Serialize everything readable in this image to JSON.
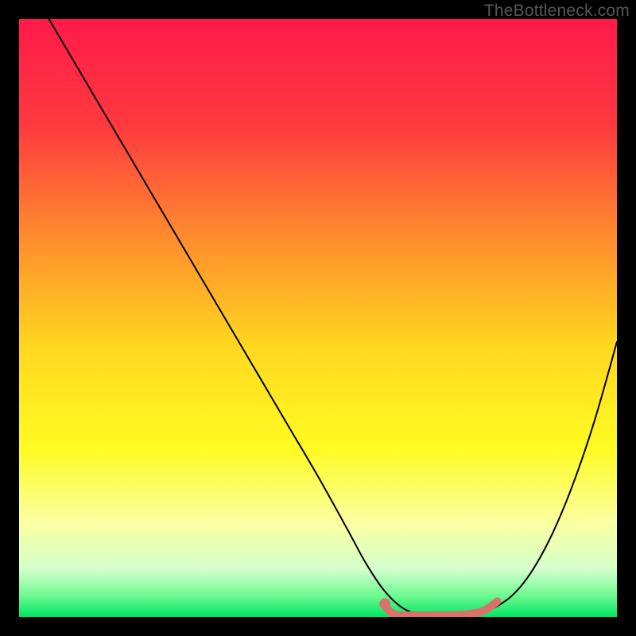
{
  "attribution": "TheBottleneck.com",
  "chart_data": {
    "type": "line",
    "title": "",
    "xlabel": "",
    "ylabel": "",
    "xlim": [
      0,
      100
    ],
    "ylim": [
      0,
      100
    ],
    "background_gradient": {
      "stops": [
        {
          "offset": 0.0,
          "color": "#ff1a4a"
        },
        {
          "offset": 0.18,
          "color": "#ff3a3f"
        },
        {
          "offset": 0.36,
          "color": "#ff8a2e"
        },
        {
          "offset": 0.55,
          "color": "#ffd81f"
        },
        {
          "offset": 0.72,
          "color": "#fffb23"
        },
        {
          "offset": 0.84,
          "color": "#fbffa0"
        },
        {
          "offset": 0.92,
          "color": "#d4ffcb"
        },
        {
          "offset": 0.965,
          "color": "#6cf992"
        },
        {
          "offset": 1.0,
          "color": "#00e663"
        }
      ]
    },
    "series": [
      {
        "name": "curve",
        "color": "#000000",
        "width": 2.0,
        "x": [
          5,
          10,
          15,
          20,
          25,
          30,
          35,
          40,
          45,
          50,
          55,
          58,
          61,
          64,
          67,
          70,
          73,
          76,
          80,
          84,
          88,
          92,
          96,
          100
        ],
        "y": [
          100,
          91.5,
          83,
          74.5,
          66,
          57.5,
          49,
          40.5,
          32,
          23.5,
          14.5,
          9,
          4.5,
          1.6,
          0.4,
          0,
          0,
          0.4,
          1.8,
          5.2,
          11.5,
          20.5,
          32.0,
          46.0
        ]
      }
    ],
    "marker_segment": {
      "name": "highlight",
      "color": "#d9726b",
      "width": 10,
      "cap": "round",
      "x": [
        61.5,
        63,
        66,
        70,
        74,
        77.5,
        80.0
      ],
      "y": [
        1.4,
        0.35,
        0.25,
        0.25,
        0.35,
        0.95,
        2.6
      ]
    },
    "marker_dot": {
      "name": "highlight-start-dot",
      "color": "#d9726b",
      "r": 7,
      "x": 61.2,
      "y": 2.2
    }
  }
}
